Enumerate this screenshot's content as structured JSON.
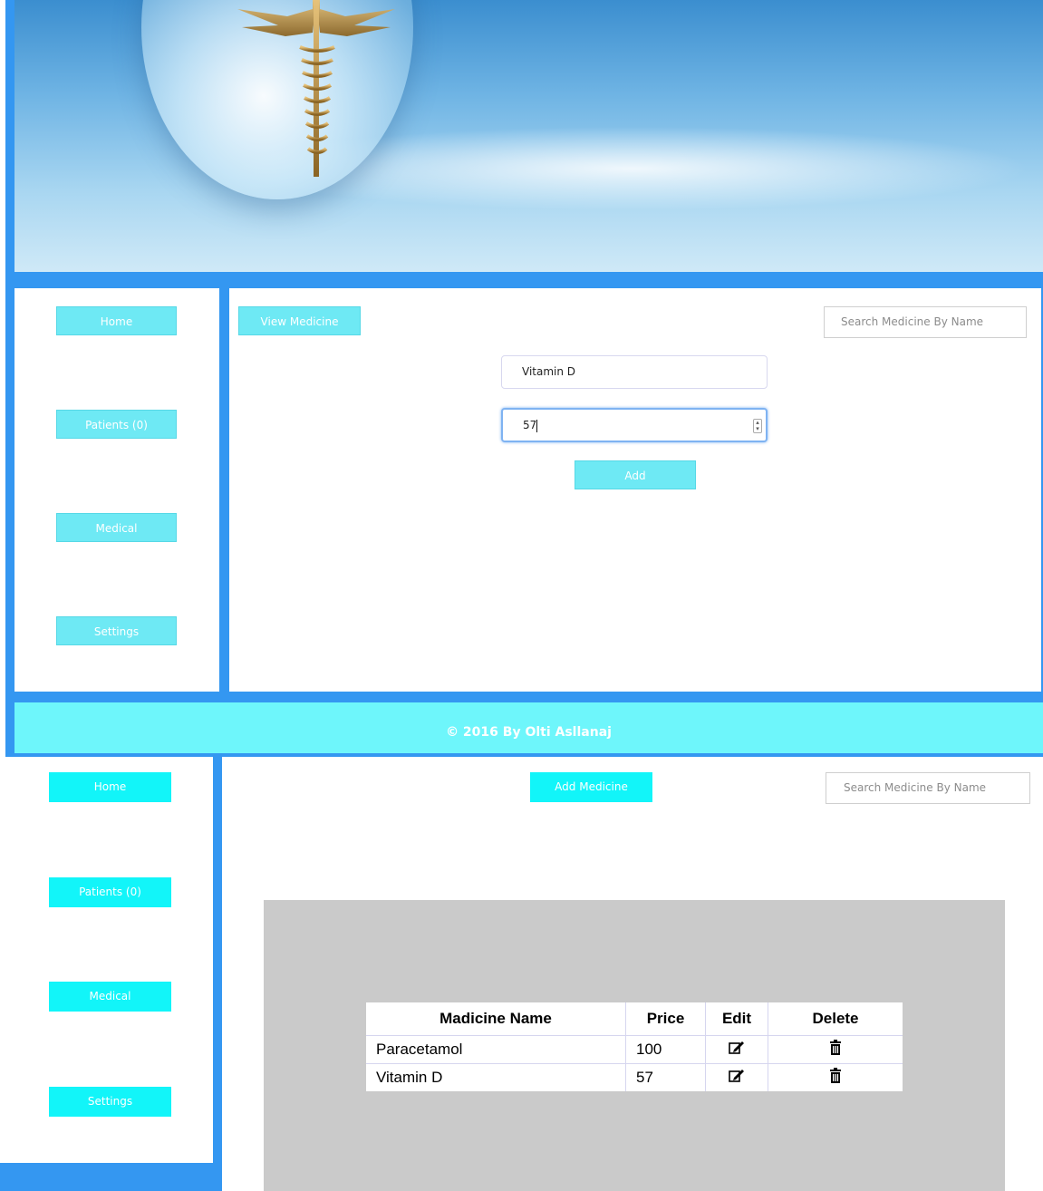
{
  "top": {
    "sidebar": {
      "items": [
        {
          "label": "Home"
        },
        {
          "label": "Patients (0)"
        },
        {
          "label": "Medical"
        },
        {
          "label": "Settings"
        }
      ]
    },
    "main": {
      "view_button": "View Medicine",
      "search_placeholder": "Search Medicine By Name",
      "name_value": "Vitamin D",
      "price_value": "57",
      "add_button": "Add"
    },
    "footer": {
      "text": "© 2016 By Olti Asllanaj"
    }
  },
  "bottom": {
    "sidebar": {
      "items": [
        {
          "label": "Home"
        },
        {
          "label": "Patients (0)"
        },
        {
          "label": "Medical"
        },
        {
          "label": "Settings"
        }
      ]
    },
    "main": {
      "add_button": "Add Medicine",
      "search_placeholder": "Search Medicine By Name",
      "table": {
        "headers": [
          "Madicine Name",
          "Price",
          "Edit",
          "Delete"
        ],
        "rows": [
          {
            "name": "Paracetamol",
            "price": "100"
          },
          {
            "name": "Vitamin D",
            "price": "57"
          }
        ]
      }
    }
  },
  "icons": {
    "edit": "edit-icon",
    "delete": "trash-icon"
  },
  "colors": {
    "frame_blue": "#3497f1",
    "button_cyan_light": "#6ee9f4",
    "button_cyan": "#12f5f9",
    "footer_cyan": "#6ef6fb",
    "panel_gray": "#cacaca"
  }
}
